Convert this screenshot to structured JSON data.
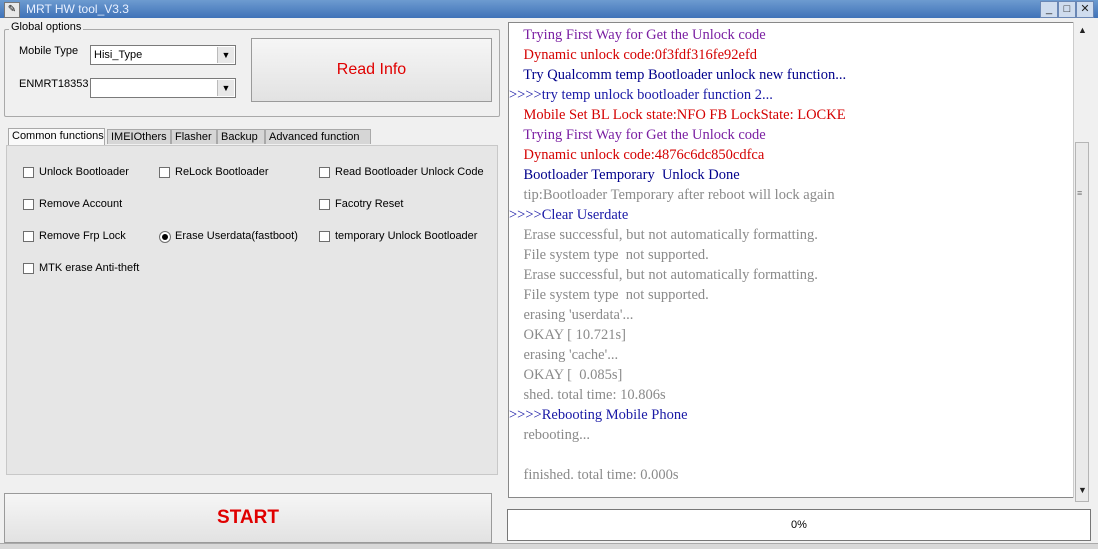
{
  "window": {
    "title": "MRT HW tool_V3.3",
    "minimize": "_",
    "maximize": "□",
    "close": "✕"
  },
  "global_options": {
    "label": "Global options",
    "mobile_type_label": "Mobile Type",
    "mobile_type_value": "Hisi_Type",
    "account_label": "ENMRT18353",
    "account_value": "",
    "read_info_label": "Read Info"
  },
  "tabs": [
    "Common functions",
    "IMEIOthers",
    "Flasher",
    "Backup",
    "Advanced function"
  ],
  "options": [
    {
      "label": "Unlock Bootloader",
      "type": "checkbox",
      "checked": false
    },
    {
      "label": "ReLock Bootloader",
      "type": "checkbox",
      "checked": false
    },
    {
      "label": "Read Bootloader Unlock Code",
      "type": "checkbox",
      "checked": false
    },
    {
      "label": "Remove Account",
      "type": "checkbox",
      "checked": false
    },
    {
      "label": "Facotry Reset",
      "type": "checkbox",
      "checked": false
    },
    {
      "label": "Remove Frp Lock",
      "type": "checkbox",
      "checked": false
    },
    {
      "label": "Erase Userdata(fastboot)",
      "type": "radio",
      "checked": true
    },
    {
      "label": "temporary Unlock Bootloader",
      "type": "checkbox",
      "checked": false
    },
    {
      "label": "MTK erase Anti-theft",
      "type": "checkbox",
      "checked": false
    }
  ],
  "start_label": "START",
  "log": [
    {
      "text": "    Trying First Way for Get the Unlock code",
      "color": "#7a1fa2"
    },
    {
      "text": "    Dynamic unlock code:0f3fdf316fe92efd",
      "color": "#d40000"
    },
    {
      "text": "    Try Qualcomm temp Bootloader unlock new function...",
      "color": "#00008b"
    },
    {
      "text": ">>>>try temp unlock bootloader function 2...",
      "color": "#1a1aa6"
    },
    {
      "text": "    Mobile Set BL Lock state:NFO FB LockState: LOCKE",
      "color": "#d40000"
    },
    {
      "text": "    Trying First Way for Get the Unlock code",
      "color": "#7a1fa2"
    },
    {
      "text": "    Dynamic unlock code:4876c6dc850cdfca",
      "color": "#d40000"
    },
    {
      "text": "    Bootloader Temporary  Unlock Done",
      "color": "#00008b"
    },
    {
      "text": "    tip:Bootloader Temporary after reboot will lock again",
      "color": "#8a8a8a"
    },
    {
      "text": ">>>>Clear Userdate",
      "color": "#1a1aa6"
    },
    {
      "text": "    Erase successful, but not automatically formatting.",
      "color": "#8a8a8a"
    },
    {
      "text": "    File system type  not supported.",
      "color": "#8a8a8a"
    },
    {
      "text": "    Erase successful, but not automatically formatting.",
      "color": "#8a8a8a"
    },
    {
      "text": "    File system type  not supported.",
      "color": "#8a8a8a"
    },
    {
      "text": "    erasing 'userdata'...",
      "color": "#8a8a8a"
    },
    {
      "text": "    OKAY [ 10.721s]",
      "color": "#8a8a8a"
    },
    {
      "text": "    erasing 'cache'...",
      "color": "#8a8a8a"
    },
    {
      "text": "    OKAY [  0.085s]",
      "color": "#8a8a8a"
    },
    {
      "text": "    shed. total time: 10.806s",
      "color": "#8a8a8a"
    },
    {
      "text": ">>>>Rebooting Mobile Phone",
      "color": "#1a1aa6"
    },
    {
      "text": "    rebooting...",
      "color": "#8a8a8a"
    },
    {
      "text": "",
      "color": "#8a8a8a"
    },
    {
      "text": "    finished. total time: 0.000s",
      "color": "#8a8a8a"
    }
  ],
  "progress": {
    "text": "0%",
    "value": 0
  },
  "scrollbar": {
    "up": "▲",
    "down": "▼",
    "grip": "≡"
  }
}
